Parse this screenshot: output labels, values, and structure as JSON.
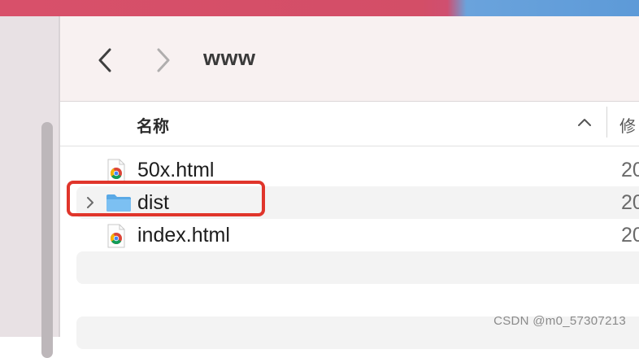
{
  "window": {
    "title": "www"
  },
  "toolbar": {
    "back_icon": "chevron-left-icon",
    "forward_icon": "chevron-right-icon"
  },
  "columns": {
    "name": "名称",
    "date_modified": "修"
  },
  "files": [
    {
      "name": "50x.html",
      "type": "html",
      "icon": "chrome-document-icon",
      "date": "20"
    },
    {
      "name": "dist",
      "type": "folder",
      "icon": "folder-icon",
      "date": "20",
      "expandable": true
    },
    {
      "name": "index.html",
      "type": "html",
      "icon": "chrome-document-icon",
      "date": "20"
    }
  ],
  "annotation": {
    "color": "#e0352b",
    "target": "dist"
  },
  "watermark": "CSDN @m0_57307213",
  "colors": {
    "folder": "#5aa9e6",
    "highlight": "#e0352b"
  }
}
